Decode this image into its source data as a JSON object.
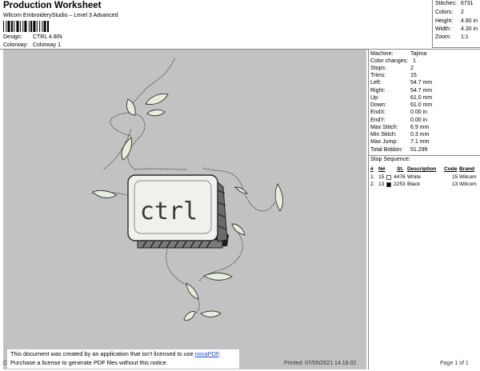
{
  "header": {
    "title": "Production Worksheet",
    "subtitle": "Wilcom EmbroideryStudio – Level 3 Advanced",
    "design_label": "Design:",
    "design_value": "CTRL 4.8IN",
    "colorway_label": "Colorway:",
    "colorway_value": "Colorway 1"
  },
  "stats": [
    {
      "label": "Stitches:",
      "value": "6731"
    },
    {
      "label": "Colors:",
      "value": "2"
    },
    {
      "label": "Height:",
      "value": "4.80 in"
    },
    {
      "label": "Width:",
      "value": "4.30 in"
    },
    {
      "label": "Zoom:",
      "value": "1:1"
    }
  ],
  "design": {
    "key_text": "ctrl",
    "background": "#c2c2c2"
  },
  "machine_info": [
    {
      "label": "Machine:",
      "value": "Tajima"
    },
    {
      "label": "Color changes:",
      "value": "1"
    },
    {
      "label": "Stops:",
      "value": "2"
    },
    {
      "label": "Trims:",
      "value": "15"
    },
    {
      "label": "Left:",
      "value": "54.7 mm"
    },
    {
      "label": "Right:",
      "value": "54.7 mm"
    },
    {
      "label": "Up:",
      "value": "61.0 mm"
    },
    {
      "label": "Down:",
      "value": "61.0 mm"
    },
    {
      "label": "EndX:",
      "value": "0.00 in"
    },
    {
      "label": "EndY:",
      "value": "0.00 in"
    },
    {
      "label": "Max Stitch:",
      "value": "6.9 mm"
    },
    {
      "label": "Min Stitch:",
      "value": "0.3 mm"
    },
    {
      "label": "Max Jump:",
      "value": "7.1 mm"
    },
    {
      "label": "Total Bobbin:",
      "value": "51.29ft"
    }
  ],
  "stop_sequence": {
    "title": "Stop Sequence:",
    "headers": [
      "#",
      "N#",
      "St.",
      "Description",
      "Code",
      "Brand"
    ],
    "rows": [
      {
        "num": "1.",
        "n": "15",
        "swatch": "#ffffff",
        "st": "4476",
        "desc": "White",
        "code": "15",
        "brand": "Wilcom"
      },
      {
        "num": "2.",
        "n": "13",
        "swatch": "#000000",
        "st": "2253",
        "desc": "Black",
        "code": "13",
        "brand": "Wilcom"
      }
    ]
  },
  "notice": {
    "line1": "This document was created by an application that isn't licensed to use ",
    "link": "novaPDF",
    "line1_end": ".",
    "line2": "Purchase a license to generate PDF files without this notice."
  },
  "footer": {
    "cr": "Cr",
    "printed": "Printed: 07/05/2021 14.18.02",
    "page": "Page 1 of 1"
  }
}
